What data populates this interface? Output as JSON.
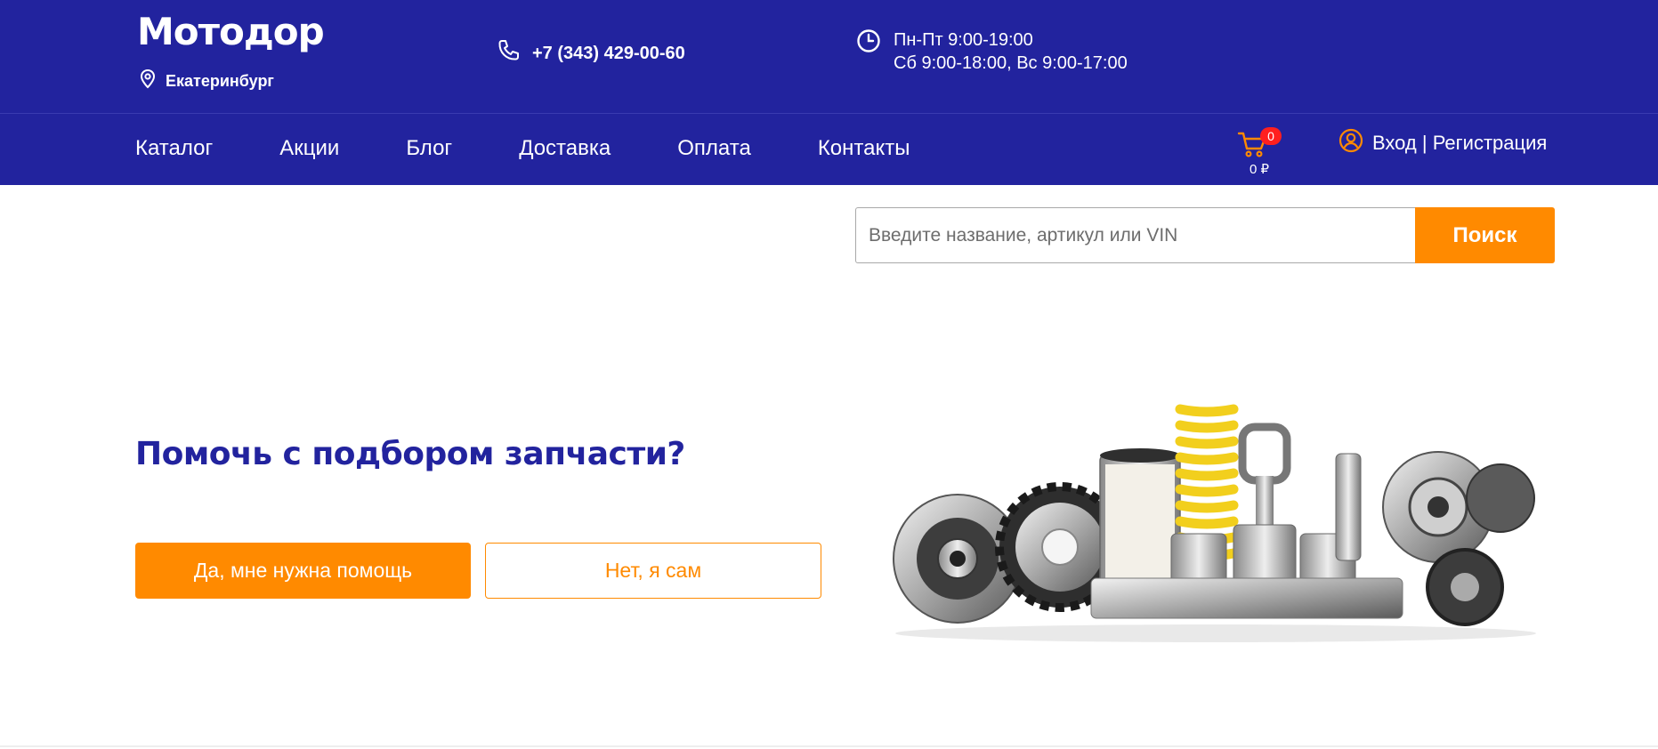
{
  "header": {
    "logo": "Мотодор",
    "city": "Екатеринбург",
    "phone": "+7 (343) 429-00-60",
    "hours_line1": "Пн-Пт 9:00-19:00",
    "hours_line2": "Сб 9:00-18:00, Вс 9:00-17:00"
  },
  "nav": {
    "items": [
      {
        "label": "Каталог"
      },
      {
        "label": "Акции"
      },
      {
        "label": "Блог"
      },
      {
        "label": "Доставка"
      },
      {
        "label": "Оплата"
      },
      {
        "label": "Контакты"
      }
    ]
  },
  "cart": {
    "count": "0",
    "sum": "0 ₽"
  },
  "account": {
    "label": "Вход | Регистрация"
  },
  "search": {
    "placeholder": "Введите название, артикул или VIN",
    "button_label": "Поиск"
  },
  "promo": {
    "title": "Помочь с подбором запчасти?",
    "yes_label": "Да, мне нужна помощь",
    "no_label": "Нет, я сам"
  },
  "colors": {
    "brand_blue": "#22239e",
    "accent_orange": "#ff8a00",
    "badge_red": "#ff1f1f"
  }
}
